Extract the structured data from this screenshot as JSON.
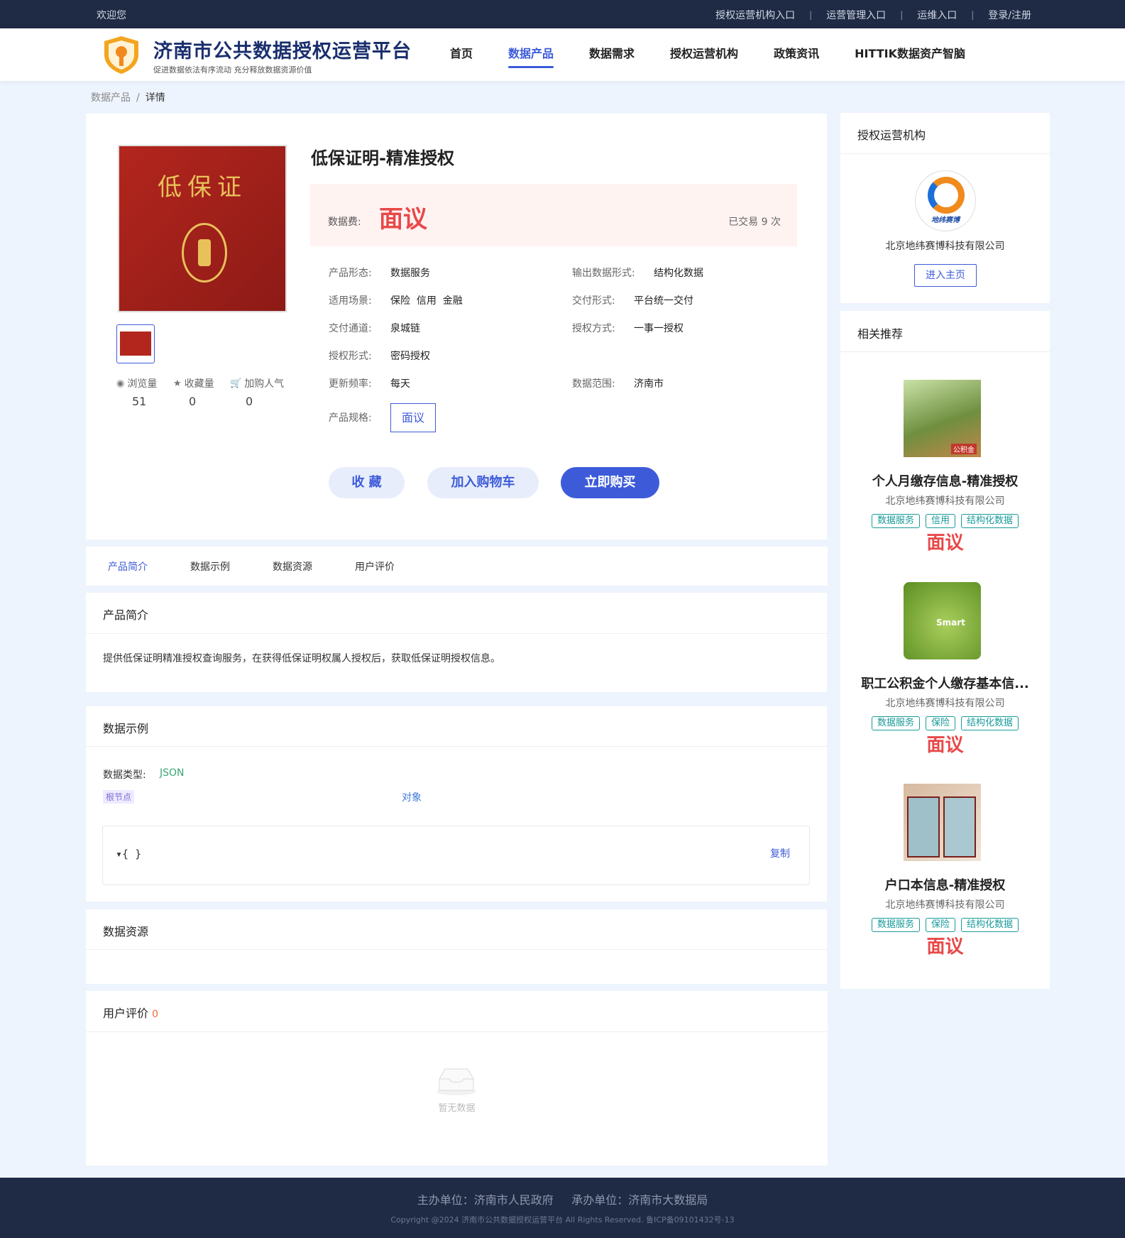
{
  "topbar": {
    "welcome": "欢迎您",
    "links": [
      "授权运营机构入口",
      "运营管理入口",
      "运维入口",
      "登录/注册"
    ]
  },
  "header": {
    "title": "济南市公共数据授权运营平台",
    "subtitle": "促进数据依法有序流动 充分释放数据资源价值",
    "nav": [
      "首页",
      "数据产品",
      "数据需求",
      "授权运营机构",
      "政策资讯",
      "HITTIK数据资产智脑"
    ],
    "active_nav": "数据产品"
  },
  "breadcrumb": {
    "parent": "数据产品",
    "sep": "/",
    "current": "详情"
  },
  "product": {
    "cover_text": "低保证",
    "title": "低保证明-精准授权",
    "price_label": "数据费:",
    "price": "面议",
    "traded": "已交易 9 次",
    "stats": [
      {
        "icon": "eye-icon",
        "label": "浏览量",
        "value": "51"
      },
      {
        "icon": "star-icon",
        "label": "收藏量",
        "value": "0"
      },
      {
        "icon": "cart-icon",
        "label": "加购人气",
        "value": "0"
      }
    ],
    "attrs": {
      "form_k": "产品形态:",
      "form_v": "数据服务",
      "output_k": "输出数据形式:",
      "output_v": "结构化数据",
      "scene_k": "适用场景:",
      "scene_v": "保险  信用  金融",
      "delivery_k": "交付形式:",
      "delivery_v": "平台统一交付",
      "channel_k": "交付通道:",
      "channel_v": "泉城链",
      "auth_k": "授权方式:",
      "auth_v": "一事一授权",
      "authform_k": "授权形式:",
      "authform_v": "密码授权",
      "freq_k": "更新频率:",
      "freq_v": "每天",
      "range_k": "数据范围:",
      "range_v": "济南市",
      "spec_k": "产品规格:",
      "spec_v": "面议"
    },
    "buttons": {
      "favorite": "收 藏",
      "cart": "加入购物车",
      "buy": "立即购买"
    }
  },
  "tabs": [
    "产品简介",
    "数据示例",
    "数据资源",
    "用户评价"
  ],
  "intro": {
    "title": "产品简介",
    "text": "提供低保证明精准授权查询服务，在获得低保证明权属人授权后，获取低保证明授权信息。"
  },
  "example": {
    "title": "数据示例",
    "type_label": "数据类型:",
    "type_value": "JSON",
    "root_tag": "根节点",
    "root_type": "对象",
    "json_text": "{ }",
    "copy": "复制"
  },
  "resources": {
    "title": "数据资源"
  },
  "reviews": {
    "title": "用户评价",
    "count": "0",
    "empty": "暂无数据"
  },
  "org": {
    "title": "授权运营机构",
    "logo_text": "地纬赛博",
    "name": "北京地纬赛博科技有限公司",
    "button": "进入主页"
  },
  "recommend": {
    "title": "相关推荐",
    "items": [
      {
        "title": "个人月缴存信息-精准授权",
        "org": "北京地纬赛博科技有限公司",
        "tags": [
          "数据服务",
          "信用",
          "结构化数据"
        ],
        "price": "面议",
        "img_label": "公积金"
      },
      {
        "title": "职工公积金个人缴存基本信...",
        "org": "北京地纬赛博科技有限公司",
        "tags": [
          "数据服务",
          "保险",
          "结构化数据"
        ],
        "price": "面议",
        "img_label": "Smart"
      },
      {
        "title": "户口本信息-精准授权",
        "org": "北京地纬赛博科技有限公司",
        "tags": [
          "数据服务",
          "保险",
          "结构化数据"
        ],
        "price": "面议",
        "img_label": ""
      }
    ]
  },
  "footer": {
    "line1": "主办单位：济南市人民政府     承办单位：济南市大数据局",
    "line2": "Copyright @2024 济南市公共数据授权运营平台 All Rights Reserved. 鲁ICP备09101432号-13"
  },
  "colors": {
    "primary": "#3d5bd9",
    "price": "#e84848",
    "tag": "#1a9a9a",
    "dark": "#1f2a44"
  }
}
